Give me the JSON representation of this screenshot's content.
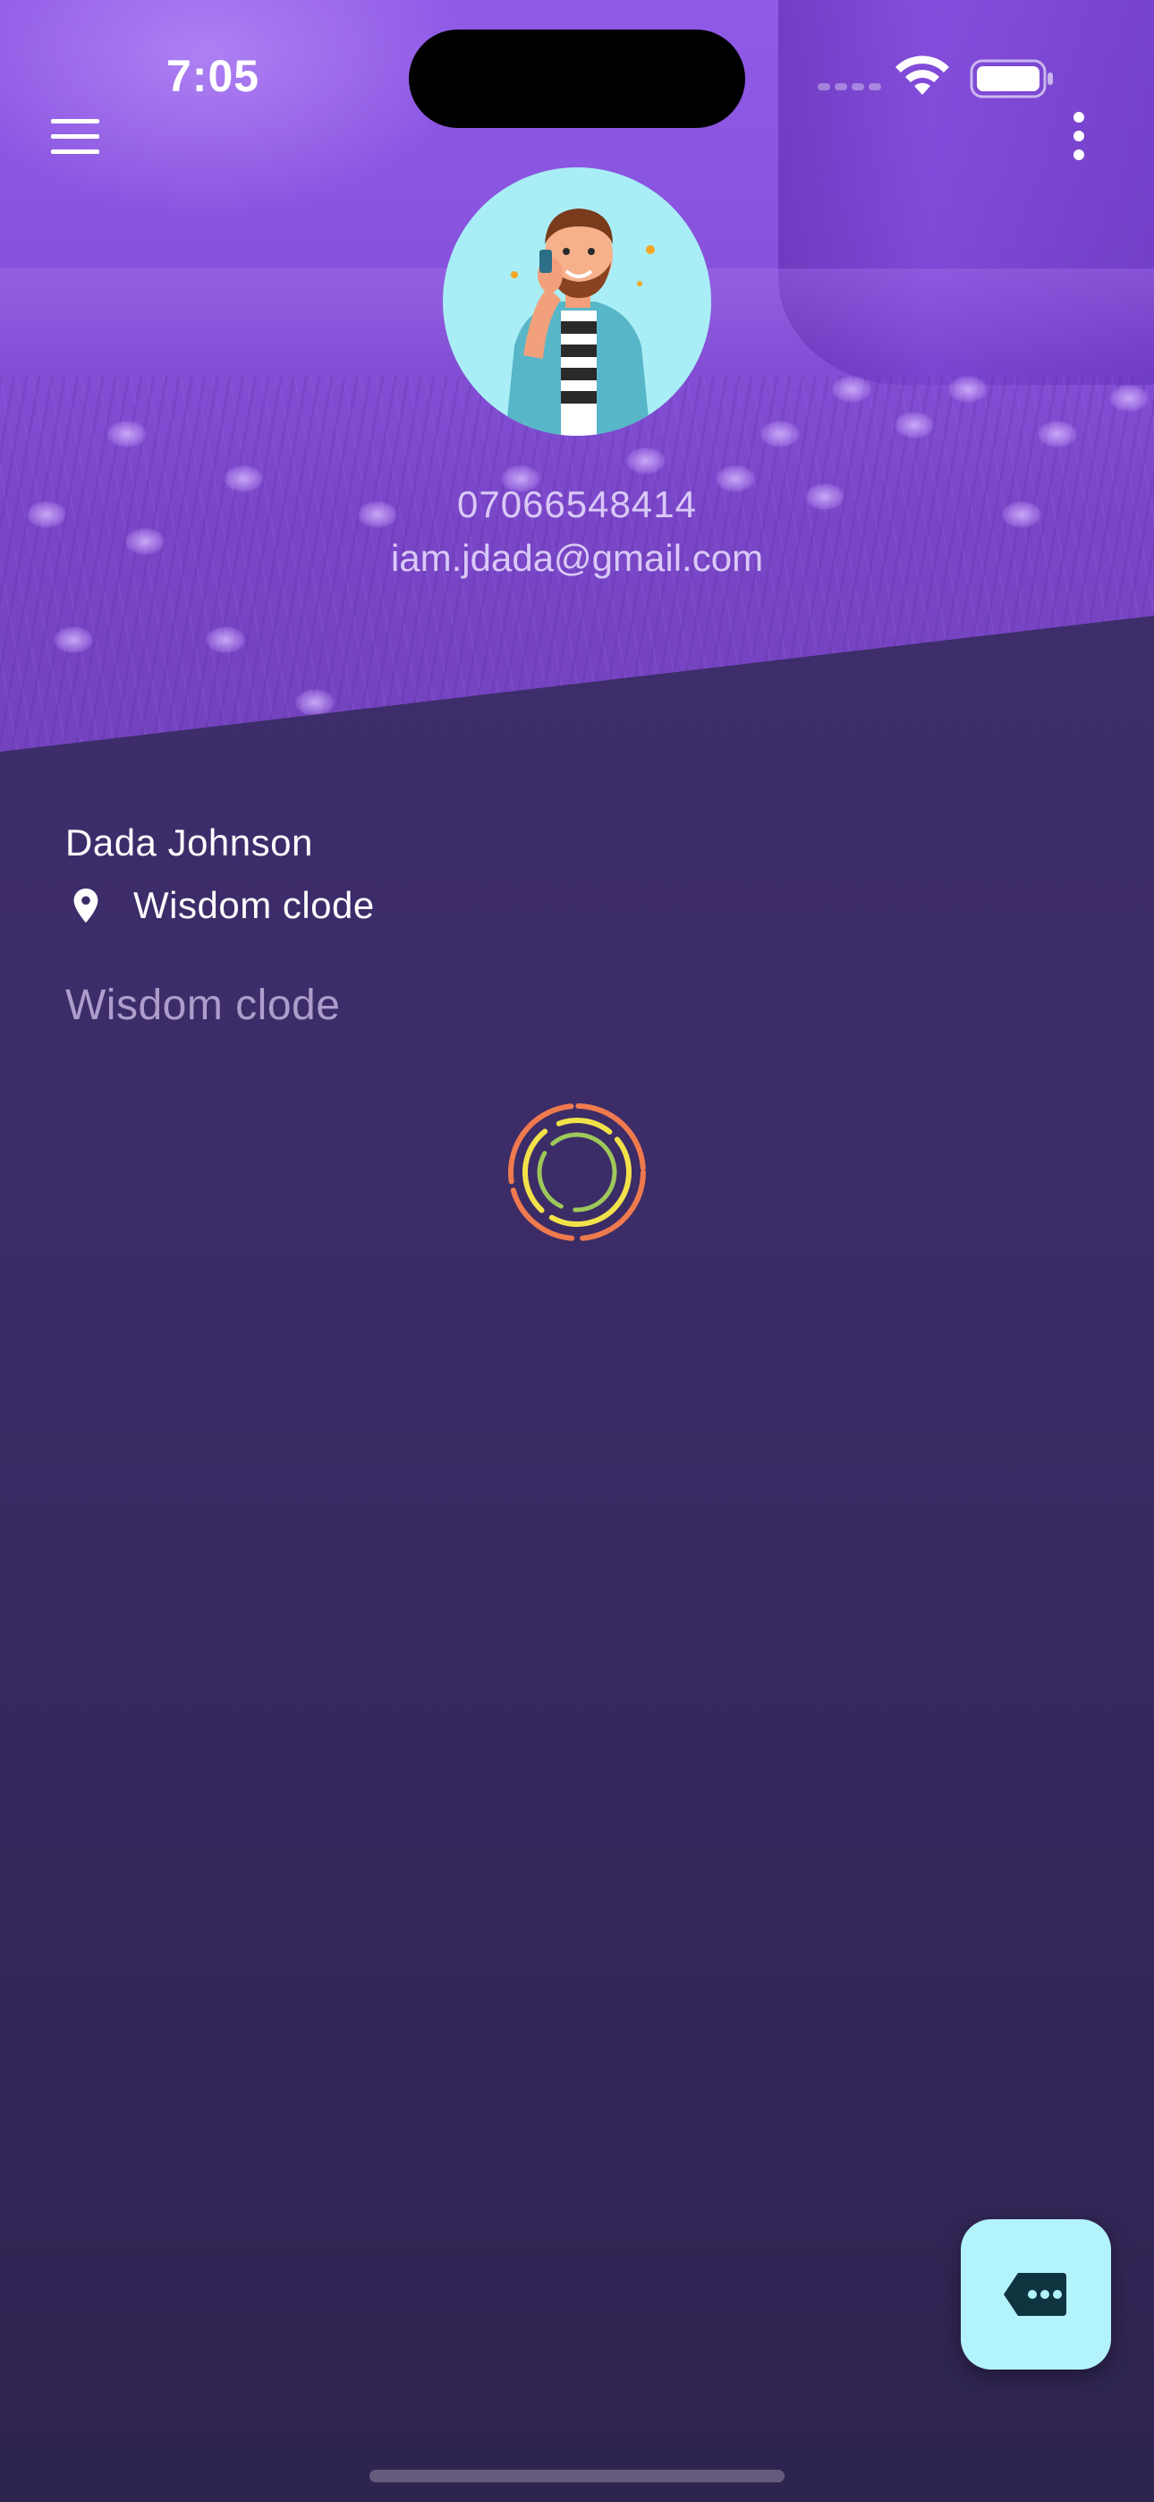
{
  "status_bar": {
    "time": "7:05",
    "icons": [
      "cellular-signal-icon",
      "wifi-icon",
      "battery-icon"
    ]
  },
  "app_bar": {
    "menu_icon": "hamburger-menu-icon",
    "more_icon": "more-vertical-icon"
  },
  "header": {
    "avatar_description": "illustrated-man-avatar",
    "phone": "07066548414",
    "email": "iam.jdada@gmail.com"
  },
  "profile": {
    "name": "Dada Johnson",
    "location_icon": "location-pin-icon",
    "location": "Wisdom clode",
    "bio": "Wisdom clode"
  },
  "loader": {
    "icon": "loading-spinner",
    "colors": [
      "#ef7a4e",
      "#f2e24a",
      "#9ec85a"
    ]
  },
  "fab": {
    "icon": "chat-bubble-icon",
    "color": "#b3f3fb"
  },
  "theme": {
    "header_purple": "#8450d6",
    "body_background": "#3f2e6e",
    "accent_cyan": "#a9eef6"
  }
}
